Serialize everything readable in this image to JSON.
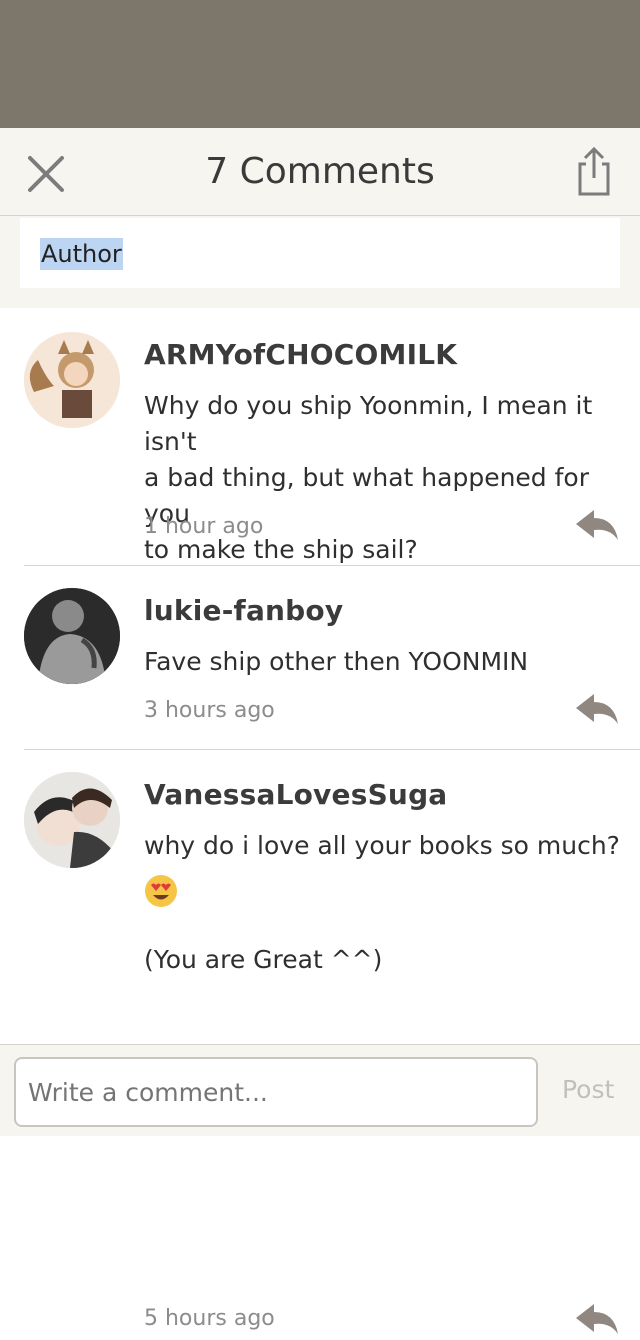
{
  "header": {
    "title": "7 Comments",
    "close_icon": "close-icon",
    "share_icon": "share-icon"
  },
  "filter": {
    "selected_text": "Author"
  },
  "comments": [
    {
      "username": "ARMYofCHOCOMILK",
      "lines": [
        "Why do you ship Yoonmin, I mean it isn't",
        "a bad thing, but what happened for you",
        "to make the ship sail?"
      ],
      "time": "1 hour ago"
    },
    {
      "username": "lukie-fanboy",
      "lines": [
        "Fave ship other then YOONMIN"
      ],
      "time": "3 hours ago"
    },
    {
      "username": "VanessaLovesSuga",
      "lines": [
        "why do i love all your books so much?"
      ],
      "emoji": "heart-eyes-emoji",
      "extra": "(You are Great ^^)",
      "time": "5 hours ago"
    }
  ],
  "footer": {
    "placeholder": "Write a comment...",
    "post_label": "Post"
  },
  "colors": {
    "backdrop": "#7d766b",
    "header_bg": "#f6f5f0",
    "selection": "#bcd5f3",
    "reply_icon": "#8f8780"
  }
}
